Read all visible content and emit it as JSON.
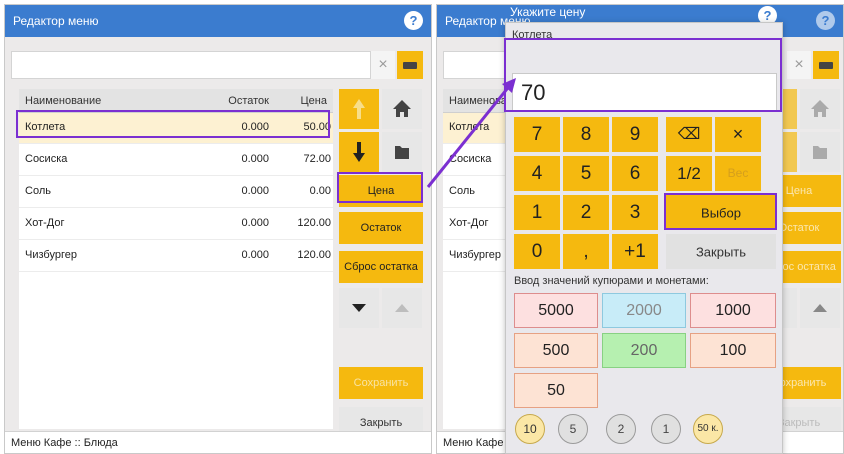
{
  "left": {
    "title": "Редактор меню",
    "table": {
      "headers": [
        "Наименование",
        "Остаток",
        "Цена"
      ],
      "rows": [
        {
          "name": "Котлета",
          "stock": "0.000",
          "price": "50.00"
        },
        {
          "name": "Сосиска",
          "stock": "0.000",
          "price": "72.00"
        },
        {
          "name": "Соль",
          "stock": "0.000",
          "price": "0.00"
        },
        {
          "name": "Хот-Дог",
          "stock": "0.000",
          "price": "120.00"
        },
        {
          "name": "Чизбургер",
          "stock": "0.000",
          "price": "120.00"
        }
      ]
    },
    "buttons": {
      "price": "Цена",
      "stock": "Остаток",
      "reset_stock": "Сброс остатка",
      "save": "Сохранить",
      "close": "Закрыть"
    },
    "status": "Меню Кафе :: Блюда"
  },
  "right": {
    "title": "Редактор меню",
    "buttons": {
      "price": "Цена",
      "stock": "Остаток",
      "reset_stock": "Сброс остатка",
      "save": "Сохранить",
      "close": "Закрыть"
    },
    "status": "Меню Кафе :: Блюда",
    "rows": [
      "Котлета",
      "Сосиска",
      "Соль",
      "Хот-Дог",
      "Чизбургер"
    ],
    "header_name": "Наименование"
  },
  "dialog": {
    "title": "Укажите цену",
    "item_name": "Котлета",
    "value": "70",
    "keys": {
      "k7": "7",
      "k8": "8",
      "k9": "9",
      "k4": "4",
      "k5": "5",
      "k6": "6",
      "k1": "1",
      "k2": "2",
      "k3": "3",
      "k0": "0",
      "comma": ",",
      "plus1": "+1",
      "backspace": "⌫",
      "clear": "×",
      "half": "1/2",
      "weight": "Вес"
    },
    "select": "Выбор",
    "close": "Закрыть",
    "bills_label": "Ввод значений купюрами и монетами:",
    "bills": [
      "5000",
      "2000",
      "1000",
      "500",
      "200",
      "100",
      "50"
    ],
    "coins": [
      "10",
      "5",
      "2",
      "1",
      "50 к."
    ]
  },
  "colors": {
    "accent": "#f5b90f",
    "titlebar": "#3b7ccf",
    "highlight": "#7b2fd1"
  }
}
